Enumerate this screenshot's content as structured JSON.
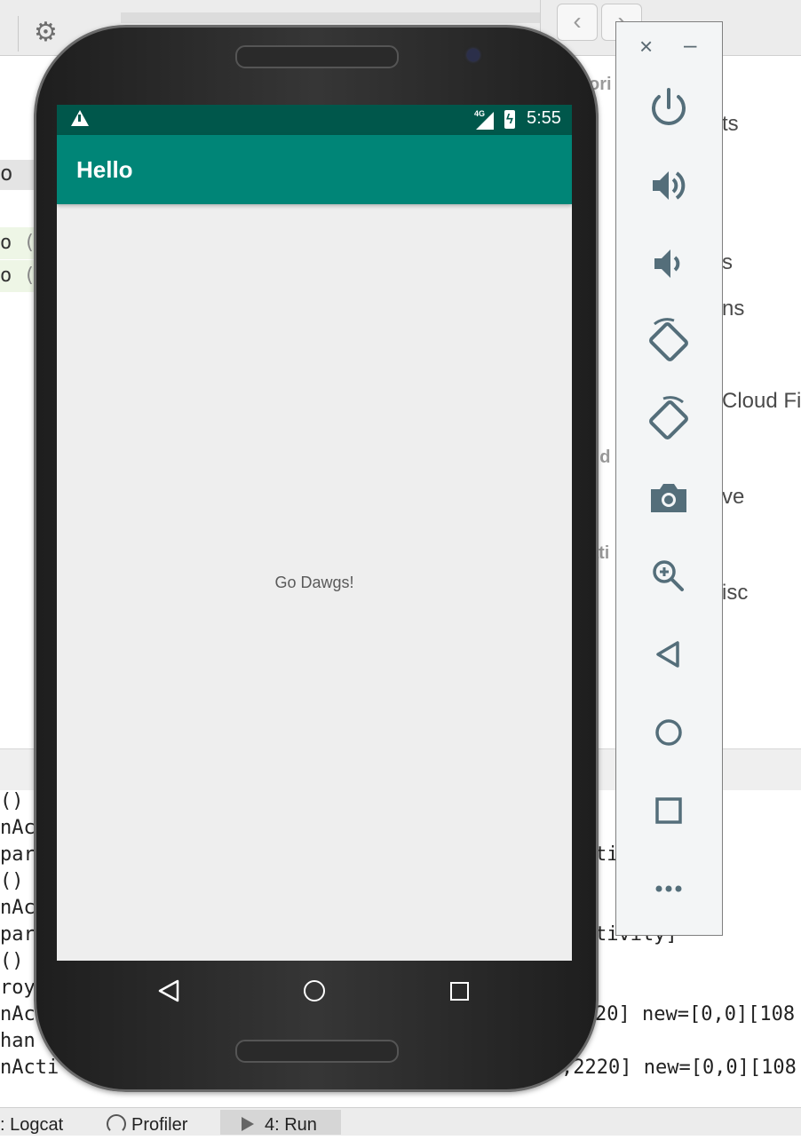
{
  "ide": {
    "highlighted_row_text": "o",
    "green_rows": [
      {
        "prefix": "o",
        "rest": " (a"
      },
      {
        "prefix": "o",
        "rest": " (t"
      }
    ],
    "log_lines": [
      "()",
      "nAc",
      "par",
      "()",
      "nAc",
      "par",
      "()",
      "roy",
      "nAc",
      "han",
      "nActi"
    ],
    "log_tails": [
      {
        "row": 2,
        "text": "ti"
      },
      {
        "row": 5,
        "text": "tivity]"
      },
      {
        "row": 8,
        "text": "20] new=[0,0][108"
      },
      {
        "row": 10,
        "text": ",2220] new=[0,0][108"
      }
    ],
    "tool_tabs": [
      {
        "label": ": Logcat",
        "icon": ""
      },
      {
        "label": "Profiler",
        "icon": "gauge-icon"
      },
      {
        "label": "4: Run",
        "icon": "play-icon"
      }
    ]
  },
  "finder": {
    "sidebar_headings": [
      "ori",
      "ud",
      "ati",
      "s"
    ],
    "sidebar_items": [
      "ts",
      "s",
      "ns",
      "Cloud Fil",
      "ve",
      "isc"
    ]
  },
  "phone": {
    "status_bar": {
      "network": "4G",
      "time": "5:55"
    },
    "app_bar_title": "Hello",
    "content_text": "Go Dawgs!"
  },
  "emulator_panel": {
    "close_label": "×",
    "minimize_label": "–",
    "buttons": [
      "power-icon",
      "volume-up-icon",
      "volume-down-icon",
      "rotate-left-icon",
      "rotate-right-icon",
      "screenshot-icon",
      "zoom-icon",
      "back-icon",
      "home-icon",
      "overview-icon",
      "more-icon"
    ]
  },
  "colors": {
    "app_bar": "#008577",
    "status_bar": "#00574b",
    "screen_bg": "#eeeeee",
    "emulator_icon": "#546e7a"
  }
}
